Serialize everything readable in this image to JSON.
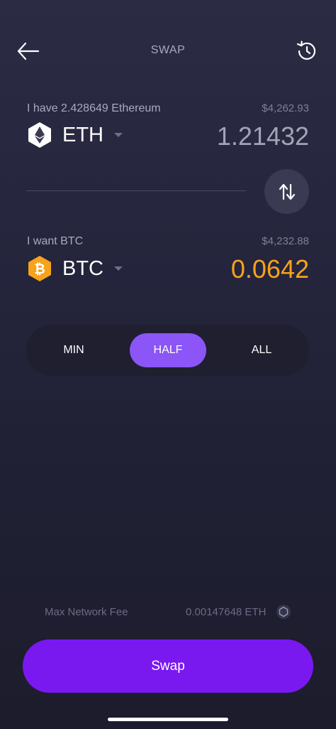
{
  "header": {
    "title": "SWAP",
    "back_icon": "arrow-left-icon",
    "history_icon": "history-icon"
  },
  "from": {
    "label": "I have 2.428649 Ethereum",
    "usd_value": "$4,262.93",
    "ticker": "ETH",
    "amount": "1.21432",
    "icon": "ethereum-icon",
    "amount_color": "#a3a3b8"
  },
  "to": {
    "label": "I want BTC",
    "usd_value": "$4,232.88",
    "ticker": "BTC",
    "amount": "0.0642",
    "icon": "bitcoin-icon",
    "amount_color": "#f7a21c"
  },
  "amount_selector": {
    "options": [
      "MIN",
      "HALF",
      "ALL"
    ],
    "selected": "HALF",
    "active_color": "#8b55f7"
  },
  "fee": {
    "label": "Max Network Fee",
    "value": "0.00147648 ETH",
    "icon": "ethereum-small-icon"
  },
  "swap_button": {
    "label": "Swap",
    "color": "#7a18f0"
  }
}
